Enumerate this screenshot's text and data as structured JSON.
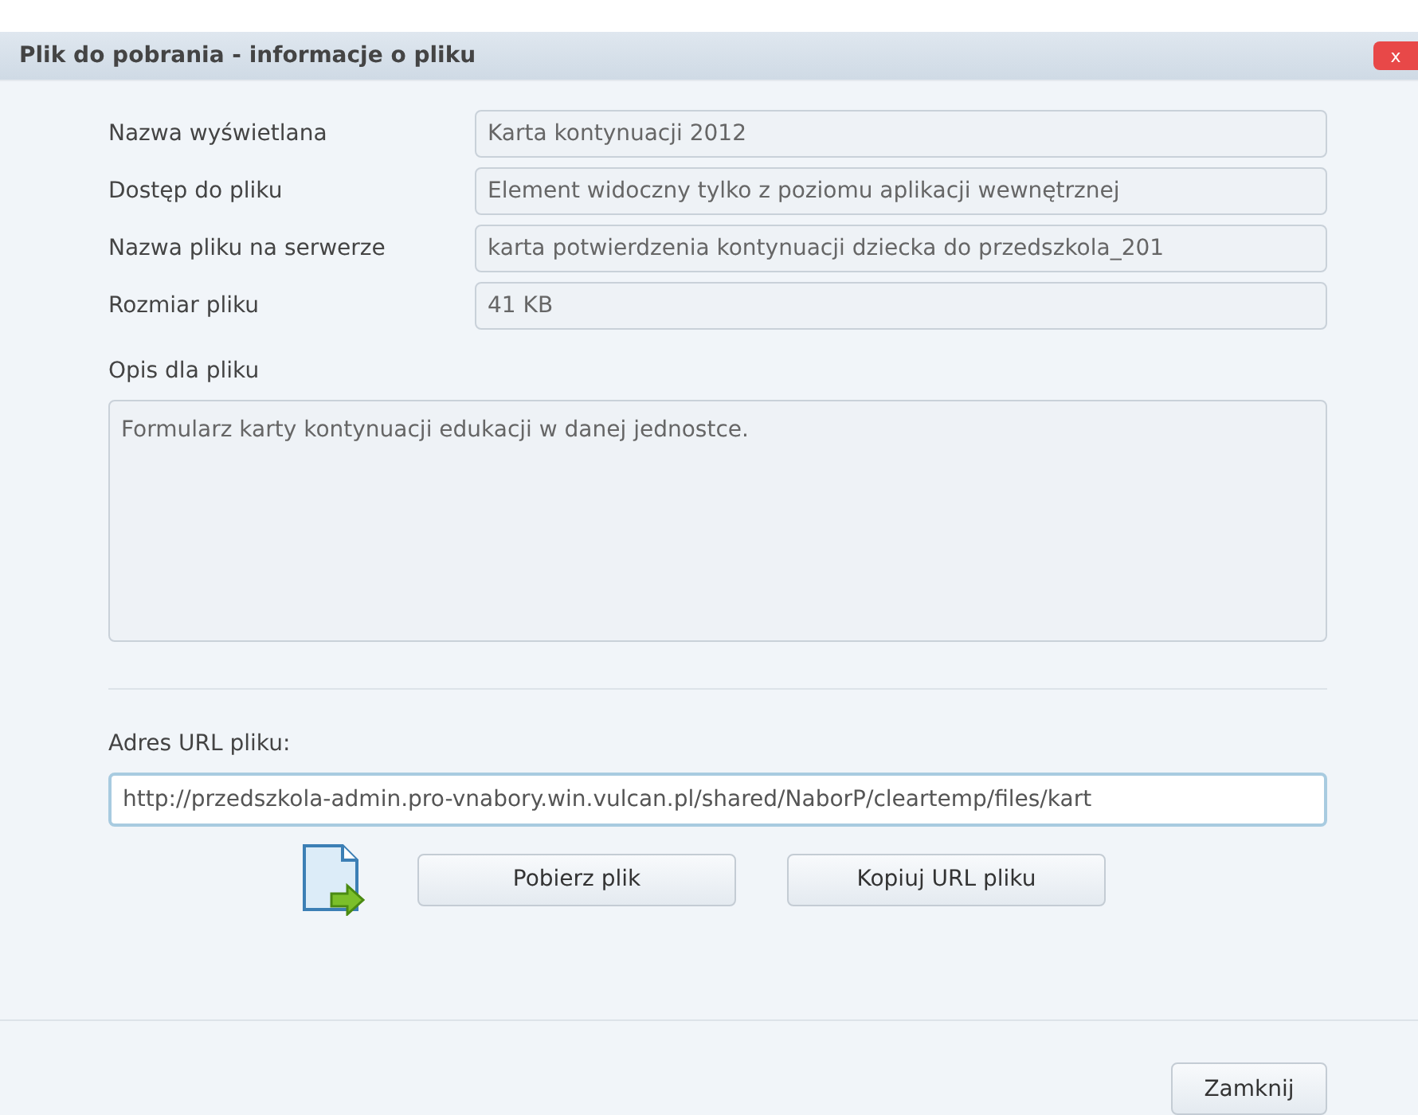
{
  "window": {
    "title": "Plik do pobrania - informacje o pliku",
    "close": "x"
  },
  "fields": [
    {
      "label": "Nazwa wyświetlana",
      "value": "Karta kontynuacji 2012"
    },
    {
      "label": "Dostęp do pliku",
      "value": "Element widoczny tylko z poziomu aplikacji wewnętrznej"
    },
    {
      "label": "Nazwa pliku na serwerze",
      "value": "karta potwierdzenia kontynuacji dziecka do przedszkola_201"
    },
    {
      "label": "Rozmiar pliku",
      "value": "41 KB"
    }
  ],
  "description": {
    "label": "Opis dla pliku",
    "value": "Formularz karty kontynuacji edukacji w danej jednostce."
  },
  "url": {
    "label": "Adres URL pliku:",
    "value": "http://przedszkola-admin.pro-vnabory.win.vulcan.pl/shared/NaborP/cleartemp/files/kart"
  },
  "actions": [
    "Pobierz plik",
    "Kopiuj URL pliku"
  ],
  "footer": {
    "close_button": "Zamknij"
  }
}
